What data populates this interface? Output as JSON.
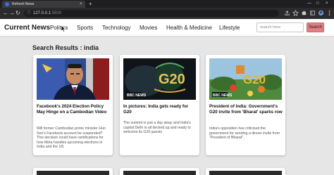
{
  "browser": {
    "tab_title": "Refresh News",
    "tab_close": "×",
    "new_tab": "+",
    "url_host": "127.0.0.1",
    "url_port": ":5500",
    "url_info_icon": "ⓘ",
    "window_controls": [
      "—",
      "□",
      "×"
    ]
  },
  "header": {
    "brand": "Current News",
    "nav": [
      "Politics",
      "Sports",
      "Technology",
      "Movies",
      "Health & Medicine",
      "Lifestyle"
    ],
    "search_placeholder": "search here",
    "search_button": "Search"
  },
  "results": {
    "heading": "Search Results : india",
    "cards": [
      {
        "title": "Facebook's 2024 Election Policy May Hinge on a Cambodian Video",
        "description": "Will former Cambodian prime minister Hun Sen's Facebook account be suspended? This decision could have ramifications for how Meta handles upcoming elections in India and the US"
      },
      {
        "title": "In pictures: India gets ready for G20",
        "description": "The summit is just a day away and India's capital Delhi is all decked up and ready to welcome its G20 guests",
        "image_logo": "BBC NEWS",
        "image_text": "G20"
      },
      {
        "title": "President of India: Government's G20 invite from 'Bharat' sparks row",
        "description": "India's opposition has criticised the government for sending a dinner invite from \"President of Bharat\".",
        "image_logo": "BBC NEWS",
        "image_text": "G20"
      }
    ]
  },
  "colors": {
    "page_bg": "#e6e6e6",
    "search_button": "#e37f82",
    "browser_chrome": "#2b2b2e"
  }
}
